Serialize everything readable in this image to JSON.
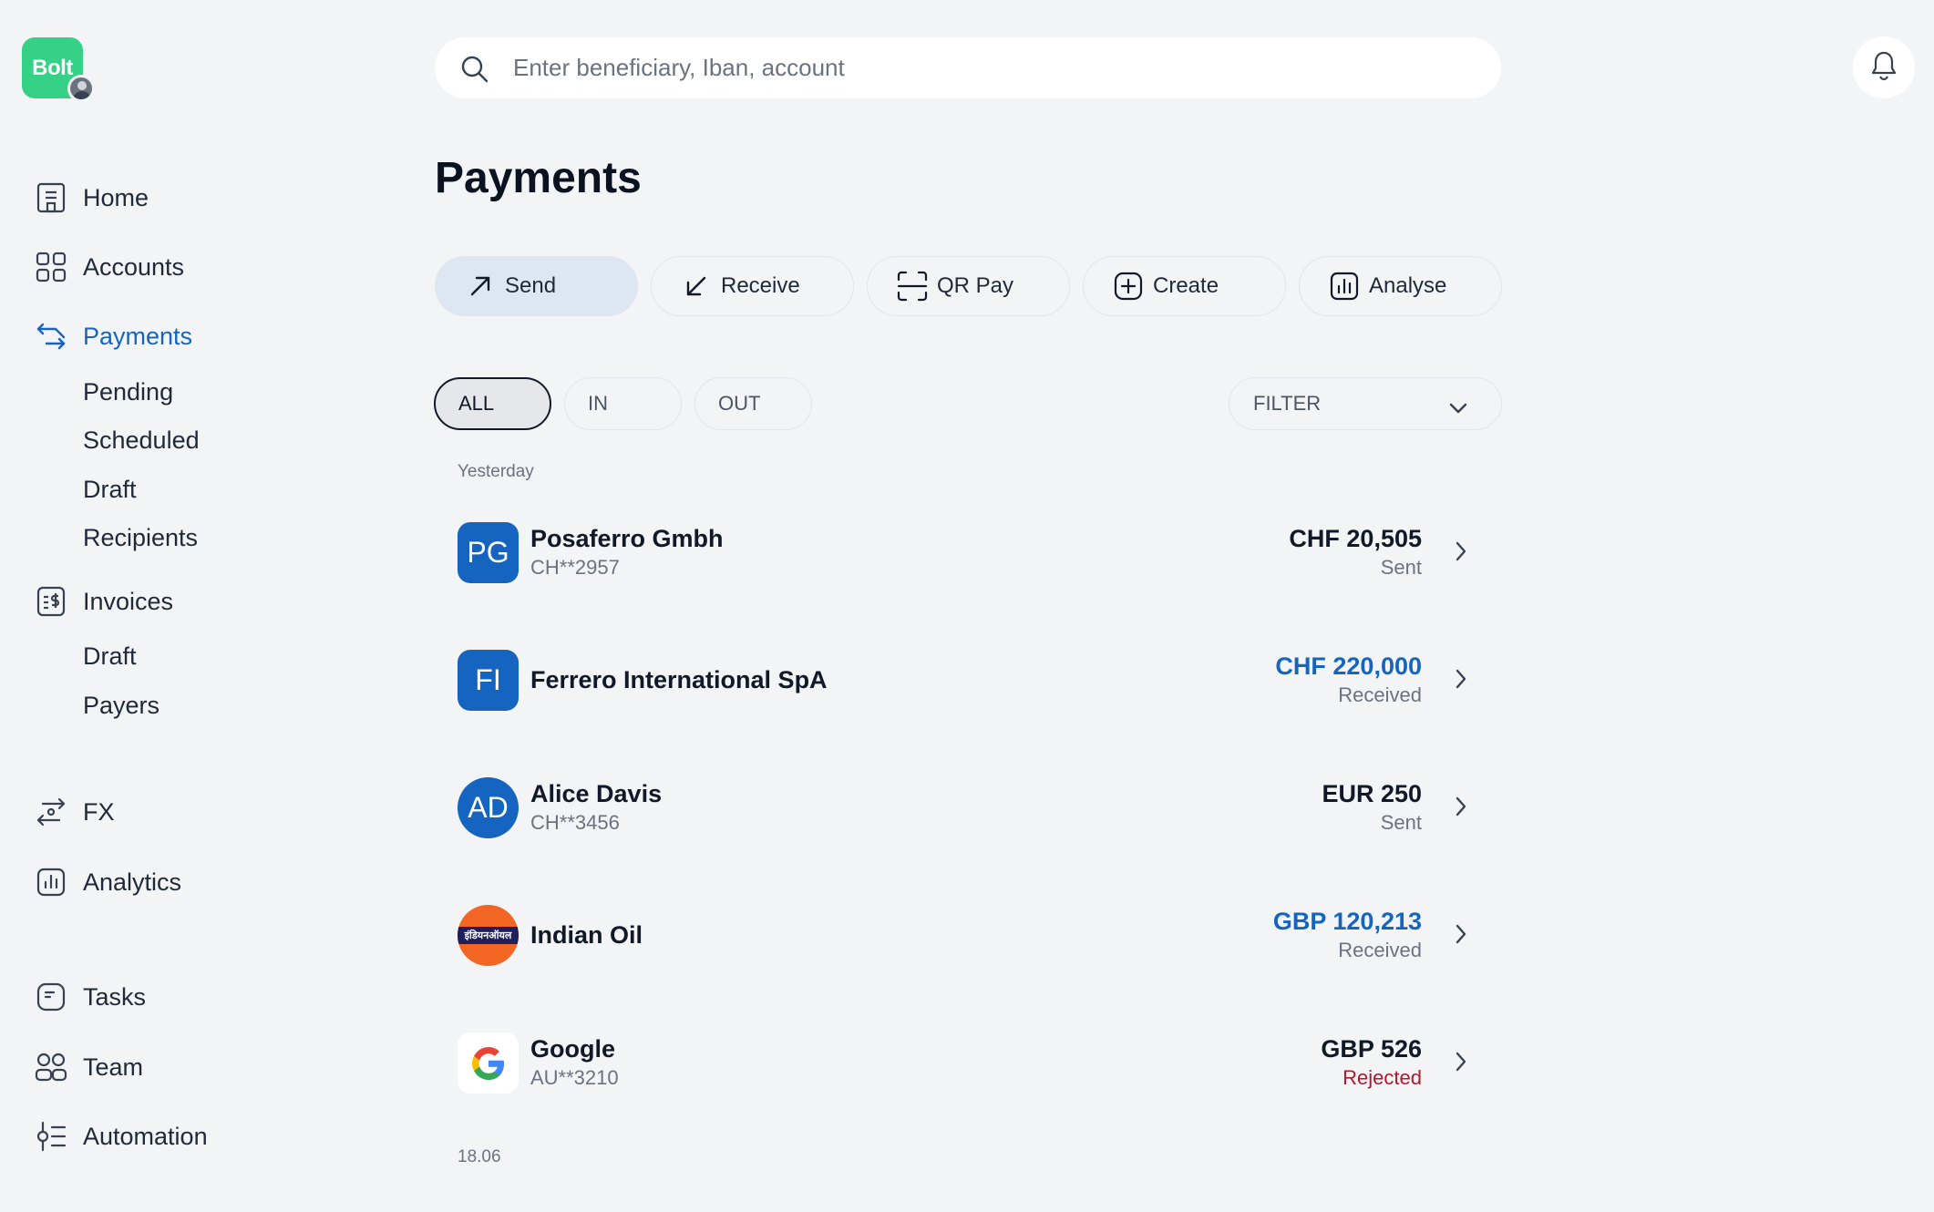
{
  "brand": {
    "logo_text": "Bolt",
    "accent": "#34d186"
  },
  "search": {
    "placeholder": "Enter beneficiary, Iban, account"
  },
  "nav": {
    "home": "Home",
    "accounts": "Accounts",
    "payments": "Payments",
    "payments_sub": [
      "Pending",
      "Scheduled",
      "Draft",
      "Recipients"
    ],
    "invoices": "Invoices",
    "invoices_sub": [
      "Draft",
      "Payers"
    ],
    "fx": "FX",
    "analytics": "Analytics",
    "tasks": "Tasks",
    "team": "Team",
    "automation": "Automation"
  },
  "page": {
    "title": "Payments"
  },
  "actions": [
    {
      "label": "Send",
      "icon": "arrow-up-right-icon"
    },
    {
      "label": "Receive",
      "icon": "arrow-down-left-icon"
    },
    {
      "label": "QR Pay",
      "icon": "qr-scan-icon"
    },
    {
      "label": "Create",
      "icon": "plus-square-icon"
    },
    {
      "label": "Analyse",
      "icon": "chart-icon"
    }
  ],
  "tabs": [
    "ALL",
    "IN",
    "OUT"
  ],
  "filter": {
    "label": "FILTER"
  },
  "groups": [
    {
      "date": "Yesterday"
    },
    {
      "date": "18.06"
    }
  ],
  "transactions": [
    {
      "initials": "PG",
      "name": "Posaferro Gmbh",
      "account": "CH**2957",
      "amount": "CHF 20,505",
      "status": "Sent"
    },
    {
      "initials": "FI",
      "name": "Ferrero International SpA",
      "account": "",
      "amount": "CHF 220,000",
      "status": "Received"
    },
    {
      "initials": "AD",
      "name": "Alice Davis",
      "account": "CH**3456",
      "amount": "EUR 250",
      "status": "Sent"
    },
    {
      "initials": "इंडियनऑयल",
      "name": "Indian Oil",
      "account": "",
      "amount": "GBP 120,213",
      "status": "Received"
    },
    {
      "initials": "G",
      "name": "Google",
      "account": "AU**3210",
      "amount": "GBP 526",
      "status": "Rejected"
    }
  ],
  "colors": {
    "active_nav": "#1565c0",
    "received": "#1565c0",
    "rejected": "#b3182b",
    "badge": "#1565c0"
  }
}
